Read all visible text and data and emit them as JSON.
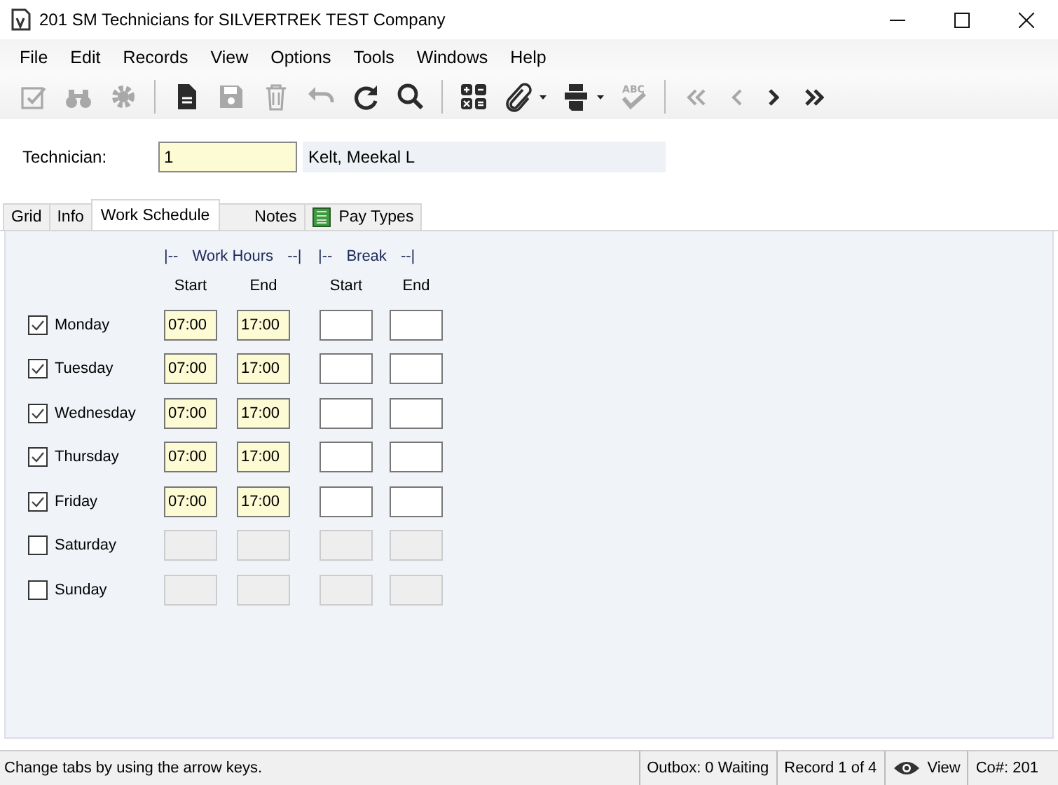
{
  "window": {
    "title": "201 SM Technicians for SILVERTREK TEST Company"
  },
  "menu": [
    "File",
    "Edit",
    "Records",
    "View",
    "Options",
    "Tools",
    "Windows",
    "Help"
  ],
  "toolbar": [
    {
      "kind": "button",
      "disabled": true
    },
    {
      "kind": "button",
      "disabled": true
    },
    {
      "kind": "button",
      "disabled": true
    },
    {
      "kind": "separator"
    },
    {
      "kind": "button",
      "disabled": false
    },
    {
      "kind": "button",
      "disabled": true
    },
    {
      "kind": "button",
      "disabled": true
    },
    {
      "kind": "button",
      "disabled": true
    },
    {
      "kind": "button",
      "disabled": false
    },
    {
      "kind": "button",
      "disabled": false
    },
    {
      "kind": "separator"
    },
    {
      "kind": "button",
      "disabled": false
    },
    {
      "kind": "dropdown",
      "disabled": false
    },
    {
      "kind": "dropdown",
      "disabled": false
    },
    {
      "kind": "button",
      "disabled": true,
      "label": "ABC"
    },
    {
      "kind": "separator"
    },
    {
      "kind": "button",
      "disabled": true
    },
    {
      "kind": "button",
      "disabled": true
    },
    {
      "kind": "button",
      "disabled": false
    },
    {
      "kind": "button",
      "disabled": false
    }
  ],
  "technician": {
    "label": "Technician:",
    "value": "1",
    "name": "Kelt, Meekal L"
  },
  "tabs": [
    {
      "label": "Grid",
      "selected": false
    },
    {
      "label": "Info",
      "selected": false
    },
    {
      "label": "Work Schedule",
      "selected": true
    },
    {
      "label": "Notes",
      "selected": false
    },
    {
      "label": "Pay Types",
      "selected": false,
      "kind": "icon"
    }
  ],
  "schedule": {
    "groups": [
      {
        "left": "|--",
        "label": "Work Hours",
        "right": "--|"
      },
      {
        "left": "|--",
        "label": "Break",
        "right": "--|"
      }
    ],
    "columns": [
      "Start",
      "End",
      "Start",
      "End"
    ],
    "days": [
      {
        "name": "Monday",
        "checked": true,
        "work_start": "07:00",
        "work_end": "17:00"
      },
      {
        "name": "Tuesday",
        "checked": true,
        "work_start": "07:00",
        "work_end": "17:00"
      },
      {
        "name": "Wednesday",
        "checked": true,
        "work_start": "07:00",
        "work_end": "17:00"
      },
      {
        "name": "Thursday",
        "checked": true,
        "work_start": "07:00",
        "work_end": "17:00"
      },
      {
        "name": "Friday",
        "checked": true,
        "work_start": "07:00",
        "work_end": "17:00"
      },
      {
        "name": "Saturday",
        "checked": false
      },
      {
        "name": "Sunday",
        "checked": false
      }
    ]
  },
  "status_bar": {
    "message": "Change tabs by using the arrow keys.",
    "outbox": "Outbox: 0 Waiting",
    "record": "Record 1 of 4",
    "mode": "View",
    "company": "Co#: 201"
  }
}
